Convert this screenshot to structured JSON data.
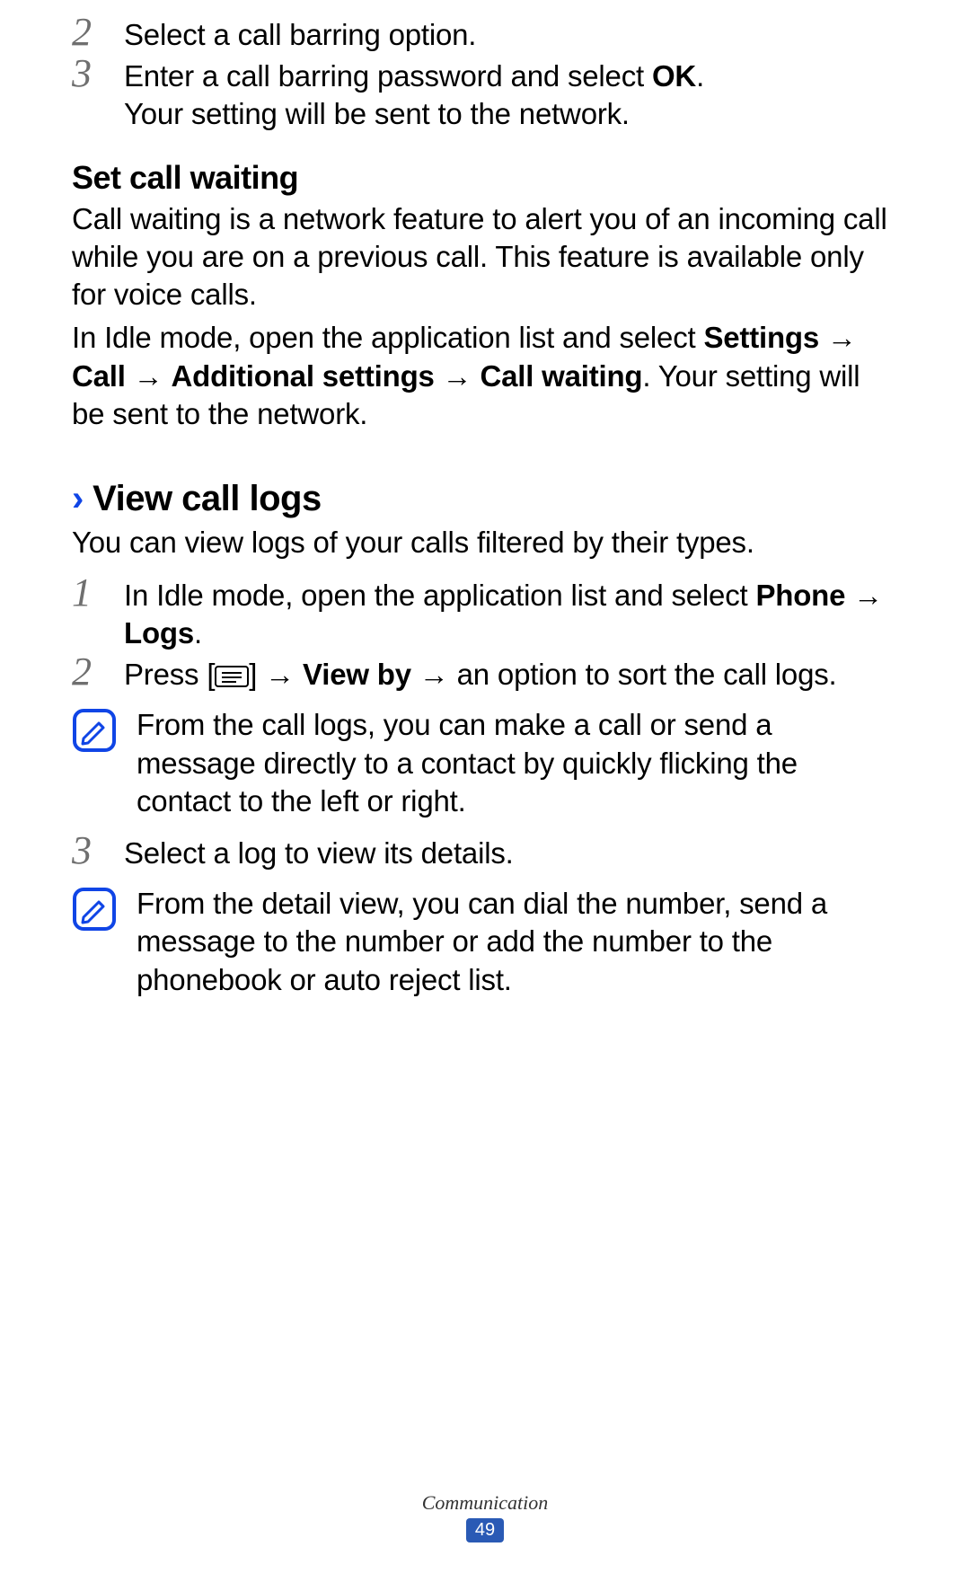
{
  "steps_top": {
    "s2": "Select a call barring option.",
    "s3a": "Enter a call barring password and select ",
    "s3_ok": "OK",
    "s3b": ".",
    "s3_line2": "Your setting will be sent to the network."
  },
  "call_waiting": {
    "heading": "Set call waiting",
    "p1": "Call waiting is a network feature to alert you of an incoming call while you are on a previous call. This feature is available only for voice calls.",
    "p2a": "In Idle mode, open the application list and select ",
    "settings": "Settings",
    "arrow": " → ",
    "call": "Call",
    "additional": "Additional settings",
    "callwaiting": "Call waiting",
    "p2b": ". Your setting will be sent to the network."
  },
  "view_logs": {
    "chevron": "›",
    "heading": "View call logs",
    "intro": "You can view logs of your calls filtered by their types.",
    "s1a": "In Idle mode, open the application list and select ",
    "phone": "Phone",
    "arrow_logs": " → ",
    "logs": "Logs",
    "period": ".",
    "s2a": "Press [",
    "s2b": "] ",
    "arrow": "→ ",
    "viewby": "View by",
    "s2c": " → an option to sort the call logs.",
    "note1": "From the call logs, you can make a call or send a message directly to a contact by quickly flicking the contact to the left or right.",
    "s3": "Select a log to view its details.",
    "note2": "From the detail view, you can dial the number, send a message to the number or add the number to the phonebook or auto reject list."
  },
  "nums": {
    "n1": "1",
    "n2": "2",
    "n3": "3"
  },
  "footer": {
    "section": "Communication",
    "page": "49"
  }
}
